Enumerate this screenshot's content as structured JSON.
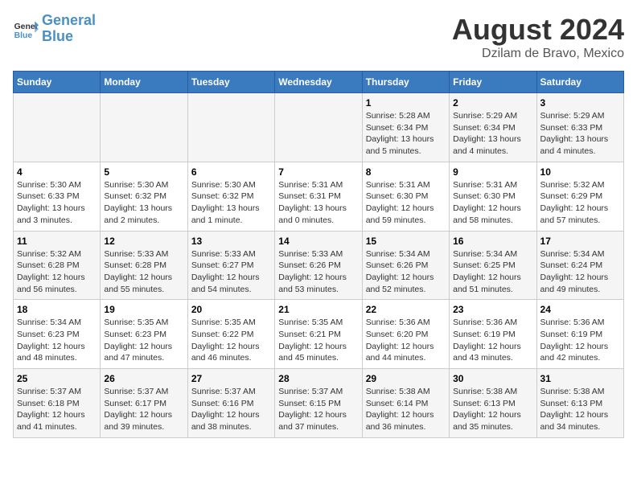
{
  "header": {
    "logo_line1": "General",
    "logo_line2": "Blue",
    "title": "August 2024",
    "subtitle": "Dzilam de Bravo, Mexico"
  },
  "weekdays": [
    "Sunday",
    "Monday",
    "Tuesday",
    "Wednesday",
    "Thursday",
    "Friday",
    "Saturday"
  ],
  "weeks": [
    [
      {
        "day": "",
        "info": ""
      },
      {
        "day": "",
        "info": ""
      },
      {
        "day": "",
        "info": ""
      },
      {
        "day": "",
        "info": ""
      },
      {
        "day": "1",
        "info": "Sunrise: 5:28 AM\nSunset: 6:34 PM\nDaylight: 13 hours\nand 5 minutes."
      },
      {
        "day": "2",
        "info": "Sunrise: 5:29 AM\nSunset: 6:34 PM\nDaylight: 13 hours\nand 4 minutes."
      },
      {
        "day": "3",
        "info": "Sunrise: 5:29 AM\nSunset: 6:33 PM\nDaylight: 13 hours\nand 4 minutes."
      }
    ],
    [
      {
        "day": "4",
        "info": "Sunrise: 5:30 AM\nSunset: 6:33 PM\nDaylight: 13 hours\nand 3 minutes."
      },
      {
        "day": "5",
        "info": "Sunrise: 5:30 AM\nSunset: 6:32 PM\nDaylight: 13 hours\nand 2 minutes."
      },
      {
        "day": "6",
        "info": "Sunrise: 5:30 AM\nSunset: 6:32 PM\nDaylight: 13 hours\nand 1 minute."
      },
      {
        "day": "7",
        "info": "Sunrise: 5:31 AM\nSunset: 6:31 PM\nDaylight: 13 hours\nand 0 minutes."
      },
      {
        "day": "8",
        "info": "Sunrise: 5:31 AM\nSunset: 6:30 PM\nDaylight: 12 hours\nand 59 minutes."
      },
      {
        "day": "9",
        "info": "Sunrise: 5:31 AM\nSunset: 6:30 PM\nDaylight: 12 hours\nand 58 minutes."
      },
      {
        "day": "10",
        "info": "Sunrise: 5:32 AM\nSunset: 6:29 PM\nDaylight: 12 hours\nand 57 minutes."
      }
    ],
    [
      {
        "day": "11",
        "info": "Sunrise: 5:32 AM\nSunset: 6:28 PM\nDaylight: 12 hours\nand 56 minutes."
      },
      {
        "day": "12",
        "info": "Sunrise: 5:33 AM\nSunset: 6:28 PM\nDaylight: 12 hours\nand 55 minutes."
      },
      {
        "day": "13",
        "info": "Sunrise: 5:33 AM\nSunset: 6:27 PM\nDaylight: 12 hours\nand 54 minutes."
      },
      {
        "day": "14",
        "info": "Sunrise: 5:33 AM\nSunset: 6:26 PM\nDaylight: 12 hours\nand 53 minutes."
      },
      {
        "day": "15",
        "info": "Sunrise: 5:34 AM\nSunset: 6:26 PM\nDaylight: 12 hours\nand 52 minutes."
      },
      {
        "day": "16",
        "info": "Sunrise: 5:34 AM\nSunset: 6:25 PM\nDaylight: 12 hours\nand 51 minutes."
      },
      {
        "day": "17",
        "info": "Sunrise: 5:34 AM\nSunset: 6:24 PM\nDaylight: 12 hours\nand 49 minutes."
      }
    ],
    [
      {
        "day": "18",
        "info": "Sunrise: 5:34 AM\nSunset: 6:23 PM\nDaylight: 12 hours\nand 48 minutes."
      },
      {
        "day": "19",
        "info": "Sunrise: 5:35 AM\nSunset: 6:23 PM\nDaylight: 12 hours\nand 47 minutes."
      },
      {
        "day": "20",
        "info": "Sunrise: 5:35 AM\nSunset: 6:22 PM\nDaylight: 12 hours\nand 46 minutes."
      },
      {
        "day": "21",
        "info": "Sunrise: 5:35 AM\nSunset: 6:21 PM\nDaylight: 12 hours\nand 45 minutes."
      },
      {
        "day": "22",
        "info": "Sunrise: 5:36 AM\nSunset: 6:20 PM\nDaylight: 12 hours\nand 44 minutes."
      },
      {
        "day": "23",
        "info": "Sunrise: 5:36 AM\nSunset: 6:19 PM\nDaylight: 12 hours\nand 43 minutes."
      },
      {
        "day": "24",
        "info": "Sunrise: 5:36 AM\nSunset: 6:19 PM\nDaylight: 12 hours\nand 42 minutes."
      }
    ],
    [
      {
        "day": "25",
        "info": "Sunrise: 5:37 AM\nSunset: 6:18 PM\nDaylight: 12 hours\nand 41 minutes."
      },
      {
        "day": "26",
        "info": "Sunrise: 5:37 AM\nSunset: 6:17 PM\nDaylight: 12 hours\nand 39 minutes."
      },
      {
        "day": "27",
        "info": "Sunrise: 5:37 AM\nSunset: 6:16 PM\nDaylight: 12 hours\nand 38 minutes."
      },
      {
        "day": "28",
        "info": "Sunrise: 5:37 AM\nSunset: 6:15 PM\nDaylight: 12 hours\nand 37 minutes."
      },
      {
        "day": "29",
        "info": "Sunrise: 5:38 AM\nSunset: 6:14 PM\nDaylight: 12 hours\nand 36 minutes."
      },
      {
        "day": "30",
        "info": "Sunrise: 5:38 AM\nSunset: 6:13 PM\nDaylight: 12 hours\nand 35 minutes."
      },
      {
        "day": "31",
        "info": "Sunrise: 5:38 AM\nSunset: 6:13 PM\nDaylight: 12 hours\nand 34 minutes."
      }
    ]
  ]
}
